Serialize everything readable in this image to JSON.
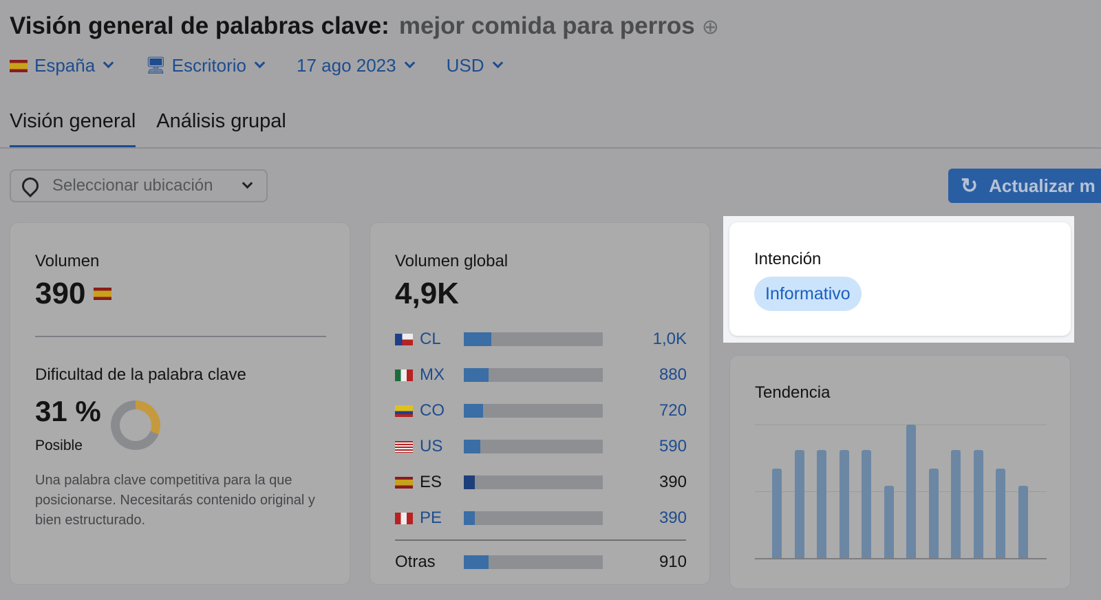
{
  "header": {
    "title": "Visión general de palabras clave:",
    "keyword": "mejor comida para perros",
    "add_icon": "plus-circle-icon"
  },
  "filters": [
    {
      "label": "España",
      "icon": "flag-es"
    },
    {
      "label": "Escritorio",
      "icon": "desktop-icon"
    },
    {
      "label": "17 ago 2023"
    },
    {
      "label": "USD"
    }
  ],
  "tabs": [
    {
      "label": "Visión general",
      "active": true
    },
    {
      "label": "Análisis grupal",
      "active": false
    }
  ],
  "location": {
    "placeholder": "Seleccionar ubicación"
  },
  "update_button": {
    "label": "Actualizar m"
  },
  "volume": {
    "label": "Volumen",
    "value": "390"
  },
  "difficulty": {
    "label": "Dificultad de la palabra clave",
    "value": "31 %",
    "level": "Posible",
    "percent": 31,
    "description": "Una palabra clave competitiva para la que posicionarse. Necesitarás contenido original y bien estructurado."
  },
  "global": {
    "label": "Volumen global",
    "value": "4,9K",
    "rows": [
      {
        "code": "CL",
        "value": "1,0K",
        "share": 20
      },
      {
        "code": "MX",
        "value": "880",
        "share": 18
      },
      {
        "code": "CO",
        "value": "720",
        "share": 14
      },
      {
        "code": "US",
        "value": "590",
        "share": 12
      },
      {
        "code": "ES",
        "value": "390",
        "share": 8
      },
      {
        "code": "PE",
        "value": "390",
        "share": 8
      }
    ],
    "other": {
      "label": "Otras",
      "value": "910",
      "share": 18
    }
  },
  "intent": {
    "label": "Intención",
    "value": "Informativo"
  },
  "trend": {
    "label": "Tendencia",
    "relative_values": [
      0.67,
      0.81,
      0.81,
      0.81,
      0.81,
      0.54,
      1,
      0.67,
      0.81,
      0.81,
      0.67,
      0.54
    ]
  },
  "colors": {
    "accent": "#2a5ea3",
    "badge_bg": "#cce4fb",
    "badge_text": "#1b5fbf",
    "difficulty": "#c59a3e"
  }
}
